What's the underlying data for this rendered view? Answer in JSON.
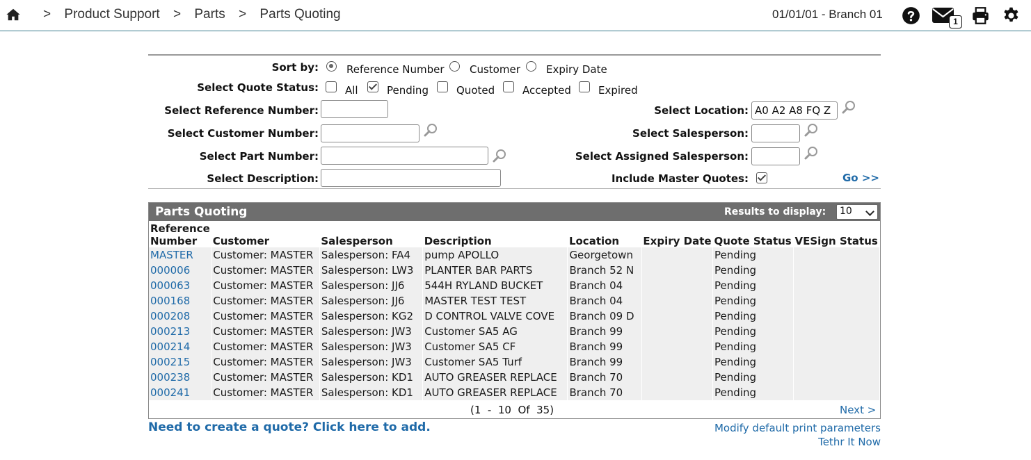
{
  "header": {
    "breadcrumbs": [
      "Product Support",
      "Parts",
      "Parts Quoting"
    ],
    "separator": ">",
    "date_branch": "01/01/01 - Branch 01",
    "mail_count": "1",
    "icons": [
      "home-icon",
      "help-icon",
      "mail-icon",
      "print-icon",
      "gear-icon"
    ]
  },
  "filters": {
    "sort_by_label": "Sort by:",
    "sort_options": [
      "Reference Number",
      "Customer",
      "Expiry Date"
    ],
    "sort_selected": "Reference Number",
    "status_label": "Select Quote Status:",
    "status_options": [
      {
        "label": "All",
        "checked": false
      },
      {
        "label": "Pending",
        "checked": true
      },
      {
        "label": "Quoted",
        "checked": false
      },
      {
        "label": "Accepted",
        "checked": false
      },
      {
        "label": "Expired",
        "checked": false
      }
    ],
    "ref_label": "Select Reference Number:",
    "ref_value": "",
    "customer_label": "Select Customer Number:",
    "customer_value": "",
    "part_label": "Select Part Number:",
    "part_value": "",
    "desc_label": "Select Description:",
    "desc_value": "",
    "location_label": "Select Location:",
    "location_value": "A0 A2 A8 FQ Z",
    "salesperson_label": "Select Salesperson:",
    "salesperson_value": "",
    "assigned_label": "Select Assigned Salesperson:",
    "assigned_value": "",
    "master_label": "Include Master Quotes:",
    "master_checked": true,
    "go_label": "Go >>"
  },
  "results": {
    "title": "Parts Quoting",
    "results_label": "Results to display:",
    "results_value": "10",
    "columns": [
      "Reference Number",
      "Customer",
      "Salesperson",
      "Description",
      "Location",
      "Expiry Date",
      "Quote Status",
      "VESign Status"
    ],
    "rows": [
      [
        "MASTER",
        "Customer: MASTER",
        "Salesperson: FA4",
        "pump APOLLO",
        "Georgetown",
        "",
        "Pending",
        ""
      ],
      [
        "000006",
        "Customer: MASTER",
        "Salesperson: LW3",
        "PLANTER BAR PARTS",
        "Branch 52 N",
        "",
        "Pending",
        ""
      ],
      [
        "000063",
        "Customer: MASTER",
        "Salesperson: JJ6",
        "544H RYLAND BUCKET",
        "Branch 04",
        "",
        "Pending",
        ""
      ],
      [
        "000168",
        "Customer: MASTER",
        "Salesperson: JJ6",
        "MASTER TEST TEST",
        "Branch 04",
        "",
        "Pending",
        ""
      ],
      [
        "000208",
        "Customer: MASTER",
        "Salesperson: KG2",
        "D CONTROL VALVE COVE",
        "Branch 09 D",
        "",
        "Pending",
        ""
      ],
      [
        "000213",
        "Customer: MASTER",
        "Salesperson: JW3",
        "Customer SA5 AG",
        "Branch 99",
        "",
        "Pending",
        ""
      ],
      [
        "000214",
        "Customer: MASTER",
        "Salesperson: JW3",
        "Customer SA5 CF",
        "Branch 99",
        "",
        "Pending",
        ""
      ],
      [
        "000215",
        "Customer: MASTER",
        "Salesperson: JW3",
        "Customer SA5 Turf",
        "Branch 99",
        "",
        "Pending",
        ""
      ],
      [
        "000238",
        "Customer: MASTER",
        "Salesperson: KD1",
        "AUTO GREASER REPLACE",
        "Branch 70",
        "",
        "Pending",
        ""
      ],
      [
        "000241",
        "Customer: MASTER",
        "Salesperson: KD1",
        "AUTO GREASER REPLACE",
        "Branch 70",
        "",
        "Pending",
        ""
      ]
    ],
    "pager": "(1  -  10  Of  35)",
    "next_label": "Next >"
  },
  "footer": {
    "add_link": "Need to create a quote? Click here to add.",
    "modify_link": "Modify default print parameters",
    "tethr_link": "Tethr It Now"
  }
}
